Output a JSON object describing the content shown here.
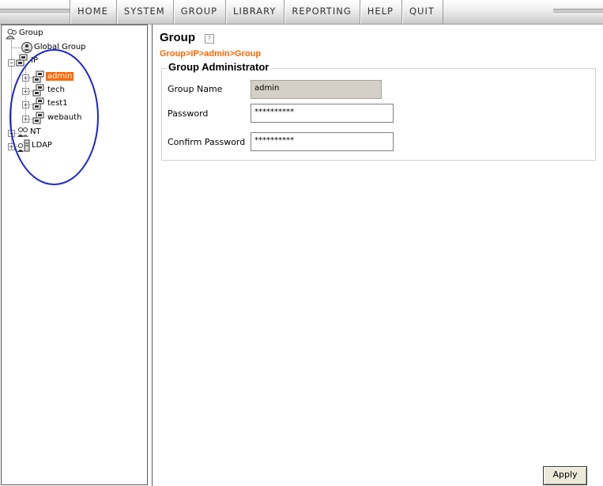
{
  "menu": {
    "items": [
      "HOME",
      "SYSTEM",
      "GROUP",
      "LIBRARY",
      "REPORTING",
      "HELP",
      "QUIT"
    ]
  },
  "tree": {
    "root": "Group",
    "global_group": "Global Group",
    "ip": "IP",
    "ip_children": [
      "admin",
      "tech",
      "test1",
      "webauth"
    ],
    "selected": "admin",
    "nt": "NT",
    "ldap": "LDAP",
    "expander_plus": "+",
    "expander_minus": "−"
  },
  "content": {
    "title": "Group",
    "help_glyph": "?",
    "breadcrumb": "Group>IP>admin>Group",
    "section_title": "Group Administrator",
    "fields": {
      "group_name_label": "Group Name",
      "group_name_value": "admin",
      "password_label": "Password",
      "password_value": "**********",
      "confirm_label": "Confirm Password",
      "confirm_value": "**********"
    },
    "apply_label": "Apply"
  },
  "colors": {
    "accent_orange": "#ff6600",
    "annotation_circle": "#1a23d6",
    "disabled_field": "#d4d0c8"
  },
  "icons": [
    "group-icon",
    "globe-user-icon",
    "network-computer-icon",
    "nt-users-icon",
    "ldap-server-icon",
    "help-icon"
  ]
}
